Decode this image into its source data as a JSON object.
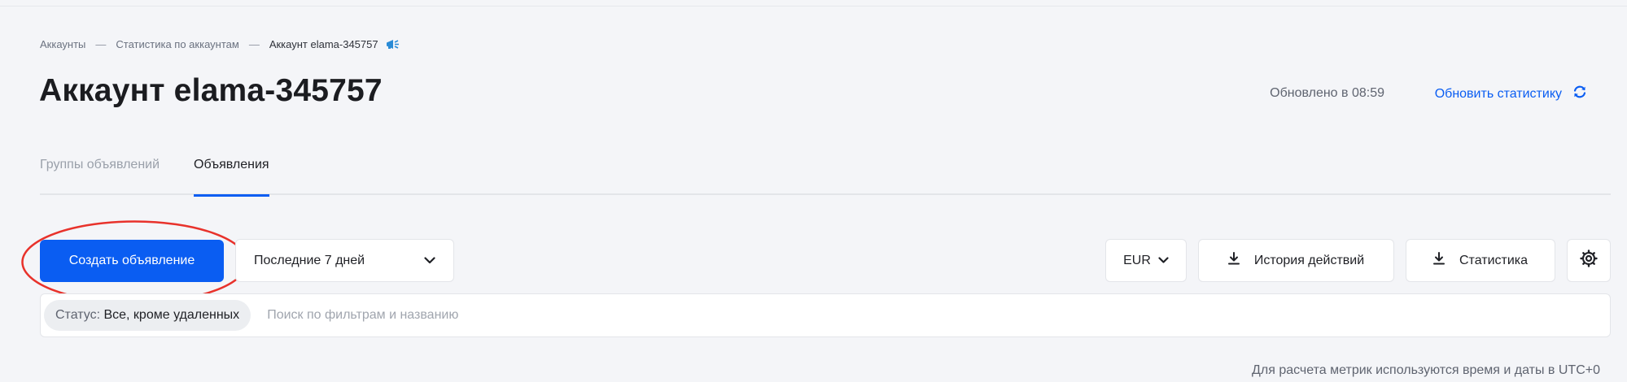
{
  "breadcrumb": {
    "items": [
      "Аккаунты",
      "Статистика по аккаунтам"
    ],
    "separator": "—",
    "current": "Аккаунт elama-345757",
    "icon": "megaphone-icon"
  },
  "header": {
    "title": "Аккаунт elama-345757",
    "updated_text": "Обновлено в 08:59",
    "refresh_label": "Обновить статистику"
  },
  "tabs": [
    {
      "label": "Группы объявлений",
      "active": false
    },
    {
      "label": "Объявления",
      "active": true
    }
  ],
  "toolbar": {
    "create_label": "Создать объявление",
    "period_value": "Последние 7 дней",
    "currency_value": "EUR",
    "history_label": "История действий",
    "stats_label": "Статистика"
  },
  "filter": {
    "status_prefix": "Статус:",
    "status_value": "Все, кроме удаленных",
    "search_placeholder": "Поиск по фильтрам и названию"
  },
  "footnote": "Для расчета метрик используются время и даты в UTC+0",
  "colors": {
    "accent": "#0a5df2",
    "highlight": "#e8322b",
    "background": "#f4f5f8"
  }
}
